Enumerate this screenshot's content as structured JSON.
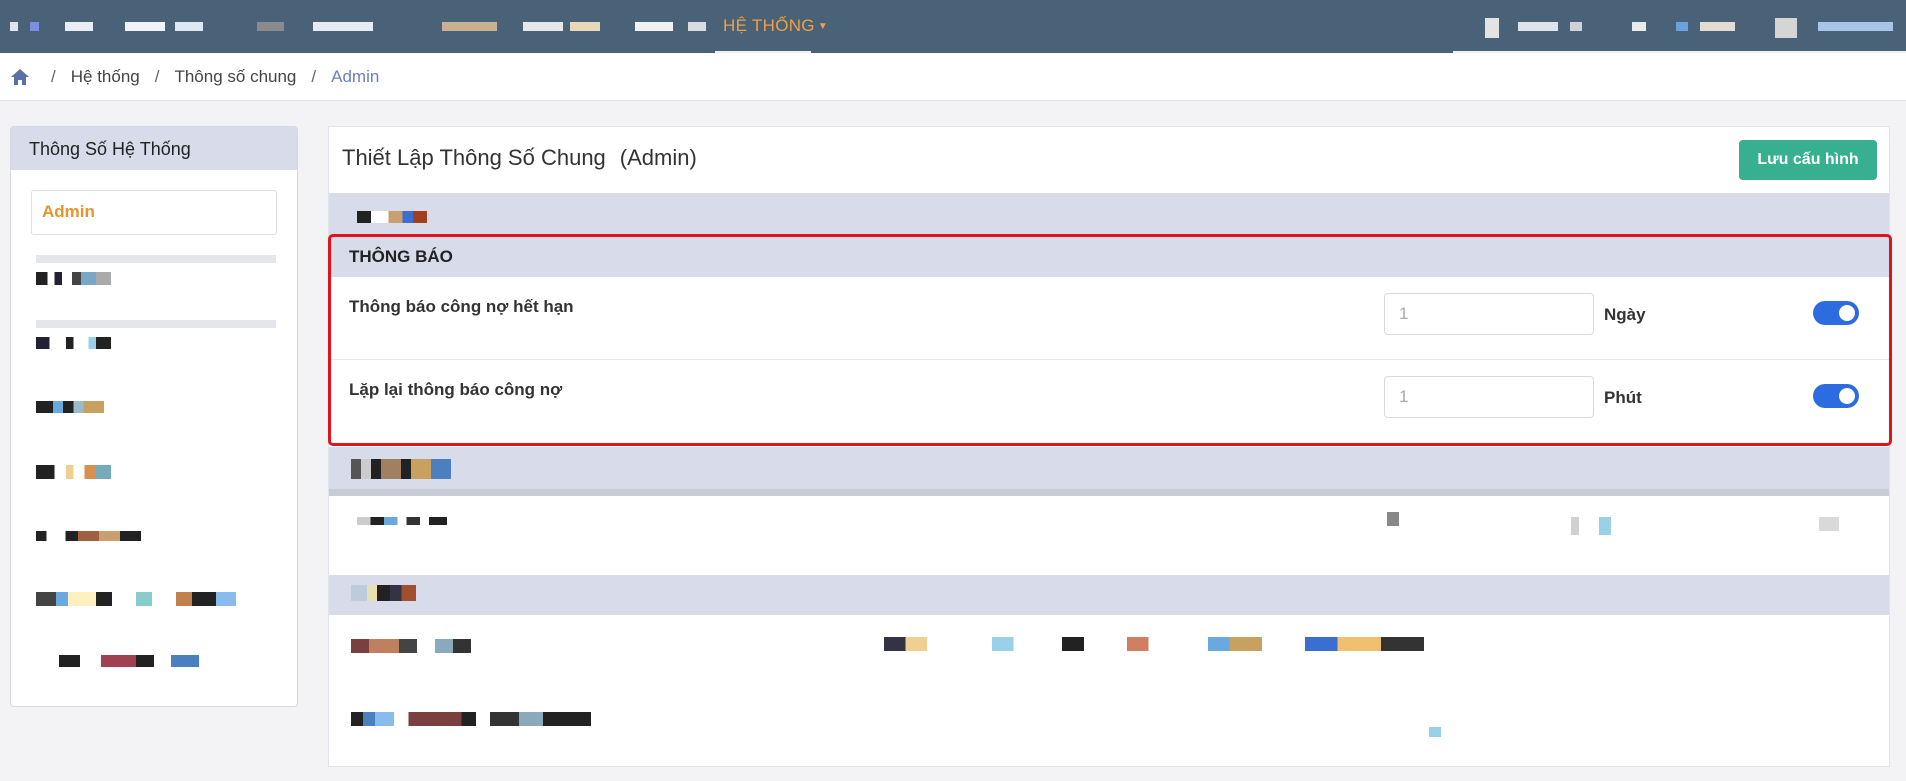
{
  "nav": {
    "active_menu": "HỆ THỐNG"
  },
  "breadcrumb": {
    "items": [
      "Hệ thống",
      "Thông số chung",
      "Admin"
    ],
    "separator": "/"
  },
  "sidebar": {
    "title": "Thông Số Hệ Thống",
    "active_item": "Admin"
  },
  "main": {
    "title": "Thiết Lập Thông Số Chung",
    "subtitle": "(Admin)",
    "save_label": "Lưu cấu hình",
    "notification": {
      "header": "THÔNG BÁO",
      "rows": [
        {
          "label": "Thông báo công nợ hết hạn",
          "value": "1",
          "unit": "Ngày",
          "enabled": true
        },
        {
          "label": "Lặp lại thông báo công nợ",
          "value": "1",
          "unit": "Phút",
          "enabled": true
        }
      ]
    }
  },
  "colors": {
    "navbar": "#4a6278",
    "accent_orange": "#e8932c",
    "save_button": "#36b08e",
    "toggle_on": "#2d6be0",
    "section_band": "#d7dbea",
    "highlight_outline": "#e0121b"
  },
  "icons": [
    "home-icon",
    "caret-down-icon"
  ]
}
